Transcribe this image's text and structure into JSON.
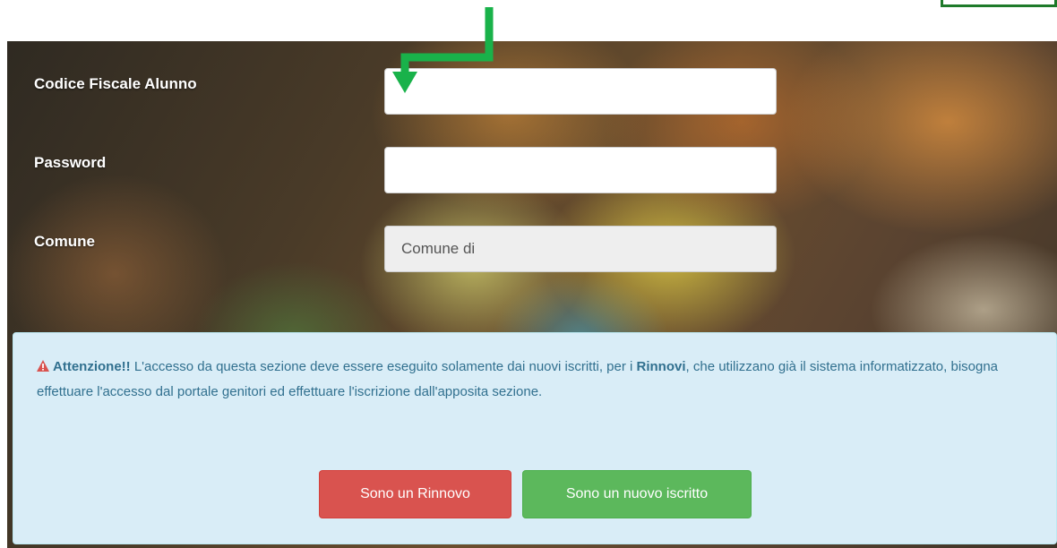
{
  "form": {
    "codice_label": "Codice Fiscale Alunno",
    "codice_value": "",
    "password_label": "Password",
    "password_value": "",
    "comune_label": "Comune",
    "comune_value": "Comune di"
  },
  "alert": {
    "title": "Attenzione!!",
    "text_before": " L'accesso da questa sezione deve essere eseguito solamente dai nuovi iscritti, per i ",
    "highlight": "Rinnovi",
    "text_after": ", che utilizzano già il sistema informatizzato, bisogna effettuare l'accesso dal portale genitori ed effettuare l'iscrizione dall'apposita sezione."
  },
  "buttons": {
    "renew_label": "Sono un Rinnovo",
    "new_label": "Sono un nuovo iscritto"
  },
  "colors": {
    "arrow": "#19b24a",
    "danger": "#d9534f",
    "success": "#5cb85c",
    "alert_bg": "#d9edf7",
    "alert_text": "#31708f"
  },
  "icons": {
    "annotation": "down-arrow-icon",
    "alert": "warning-icon"
  }
}
